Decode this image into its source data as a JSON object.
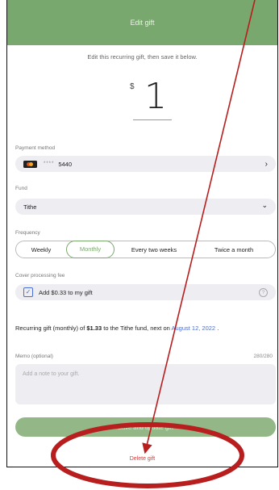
{
  "header": {
    "title": "Edit gift"
  },
  "subtitle": "Edit this recurring gift, then save it below.",
  "amount": {
    "currency": "$",
    "value": "1"
  },
  "payment": {
    "label": "Payment method",
    "masked": "****",
    "last4": "5440",
    "chevron": "›",
    "icon": "card-icon"
  },
  "fund": {
    "label": "Fund",
    "value": "Tithe",
    "chevron": "⌄"
  },
  "frequency": {
    "label": "Frequency",
    "options": [
      "Weekly",
      "Monthly",
      "Every two weeks",
      "Twice a month"
    ],
    "selected": "Monthly"
  },
  "fee": {
    "label": "Cover processing fee",
    "text": "Add $0.33 to my gift",
    "checked": true,
    "help": "?"
  },
  "summary": {
    "prefix": "Recurring gift (monthly) of ",
    "total": "$1.33",
    "middle": " to the Tithe fund, next on ",
    "date": "August 12, 2022",
    "suffix": " ."
  },
  "memo": {
    "label": "Memo (optional)",
    "count": "280/280",
    "placeholder": "Add a note to your gift."
  },
  "actions": {
    "save": "Save and update gift",
    "delete": "Delete gift"
  },
  "annotation": {
    "color": "#b81e1e"
  },
  "colors": {
    "brand": "#79a86e",
    "link": "#4a6fd4",
    "danger": "#d63a3a"
  }
}
